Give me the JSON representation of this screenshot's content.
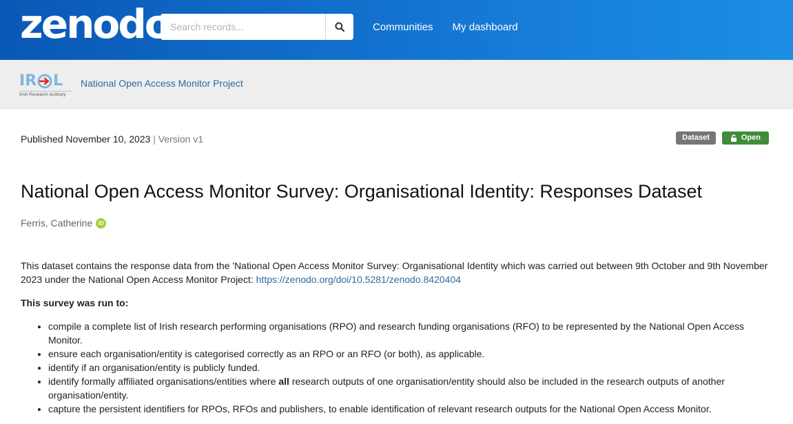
{
  "header": {
    "logo_text": "zenodo",
    "search_placeholder": "Search records...",
    "nav": [
      "Communities",
      "My dashboard"
    ]
  },
  "community": {
    "logo_text": "IREL",
    "logo_caption": "Irish Research eLibrary",
    "name": "National Open Access Monitor Project"
  },
  "record": {
    "published": "Published November 10, 2023",
    "separator": "|",
    "version": "Version v1",
    "badges": {
      "type": "Dataset",
      "access": "Open"
    },
    "title": "National Open Access Monitor Survey: Organisational Identity: Responses Dataset",
    "author": "Ferris, Catherine",
    "orcid_label": "iD"
  },
  "description": {
    "intro": "This dataset contains the response data from the 'National Open Access Monitor Survey: Organisational Identity which was carried out between 9th October and 9th November 2023 under the National Open Access Monitor Project: ",
    "intro_link": "https://zenodo.org/doi/10.5281/zenodo.8420404",
    "subheading": "This survey was run to:",
    "bullets": [
      "compile a complete list of Irish research performing organisations (RPO) and research funding organisations (RFO) to be represented by the National Open Access Monitor.",
      "ensure each organisation/entity is categorised correctly as an RPO or an RFO (or both), as applicable.",
      "identify if an organisation/entity is publicly funded."
    ],
    "bullet4": {
      "before": "identify formally affiliated organisations/entities where ",
      "bold": "all",
      "after": " research outputs of one organisation/entity should also be included in the research outputs of another organisation/entity."
    },
    "bullet5": "capture the persistent identifiers for RPOs, RFOs and publishers, to enable identification of relevant research outputs for the National Open Access Monitor."
  },
  "colors": {
    "header_gradient_start": "#0a58b5",
    "header_gradient_end": "#1c8fe4",
    "open_badge": "#3f8d3a",
    "dataset_badge": "#767676",
    "link": "#2e6ba0",
    "orcid": "#a6ce39"
  }
}
